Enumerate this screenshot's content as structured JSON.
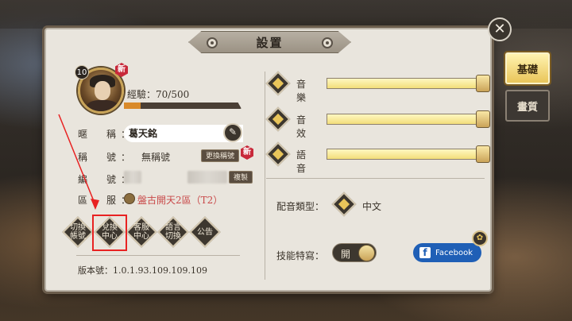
{
  "window": {
    "title": "設置"
  },
  "side_tabs": [
    {
      "label": "基礎",
      "active": true
    },
    {
      "label": "畫質",
      "active": false
    }
  ],
  "profile": {
    "level": "10",
    "new_badge": "新",
    "exp_text": "經驗：70/500",
    "exp_fraction": 0.14,
    "fields": {
      "nickname_label": "暱　稱：",
      "nickname_value": "葛天銘",
      "title_label": "稱　號：",
      "title_value": "無稱號",
      "title_button": "更換稱號",
      "id_label": "編　號：",
      "copy_button": "複製",
      "server_label": "區　服：",
      "server_value": "盤古開天2區（T2）"
    }
  },
  "action_buttons": [
    {
      "label": "切換\n帳號"
    },
    {
      "label": "兌換\n中心"
    },
    {
      "label": "客服\n中心"
    },
    {
      "label": "語言\n切換"
    },
    {
      "label": "公告"
    }
  ],
  "version": "版本號：1.0.1.93.109.109.109",
  "audio": [
    {
      "label": "音樂",
      "level": 1.0
    },
    {
      "label": "音效",
      "level": 1.0
    },
    {
      "label": "語音",
      "level": 1.0
    }
  ],
  "voice": {
    "label": "配音類型：",
    "value": "中文"
  },
  "skill": {
    "label": "技能特寫：",
    "toggle_text": "開"
  },
  "facebook": {
    "label": "Facebook"
  },
  "colors": {
    "accent": "#e9c55a",
    "highlight": "#e82222",
    "facebook": "#1f5fb6"
  }
}
